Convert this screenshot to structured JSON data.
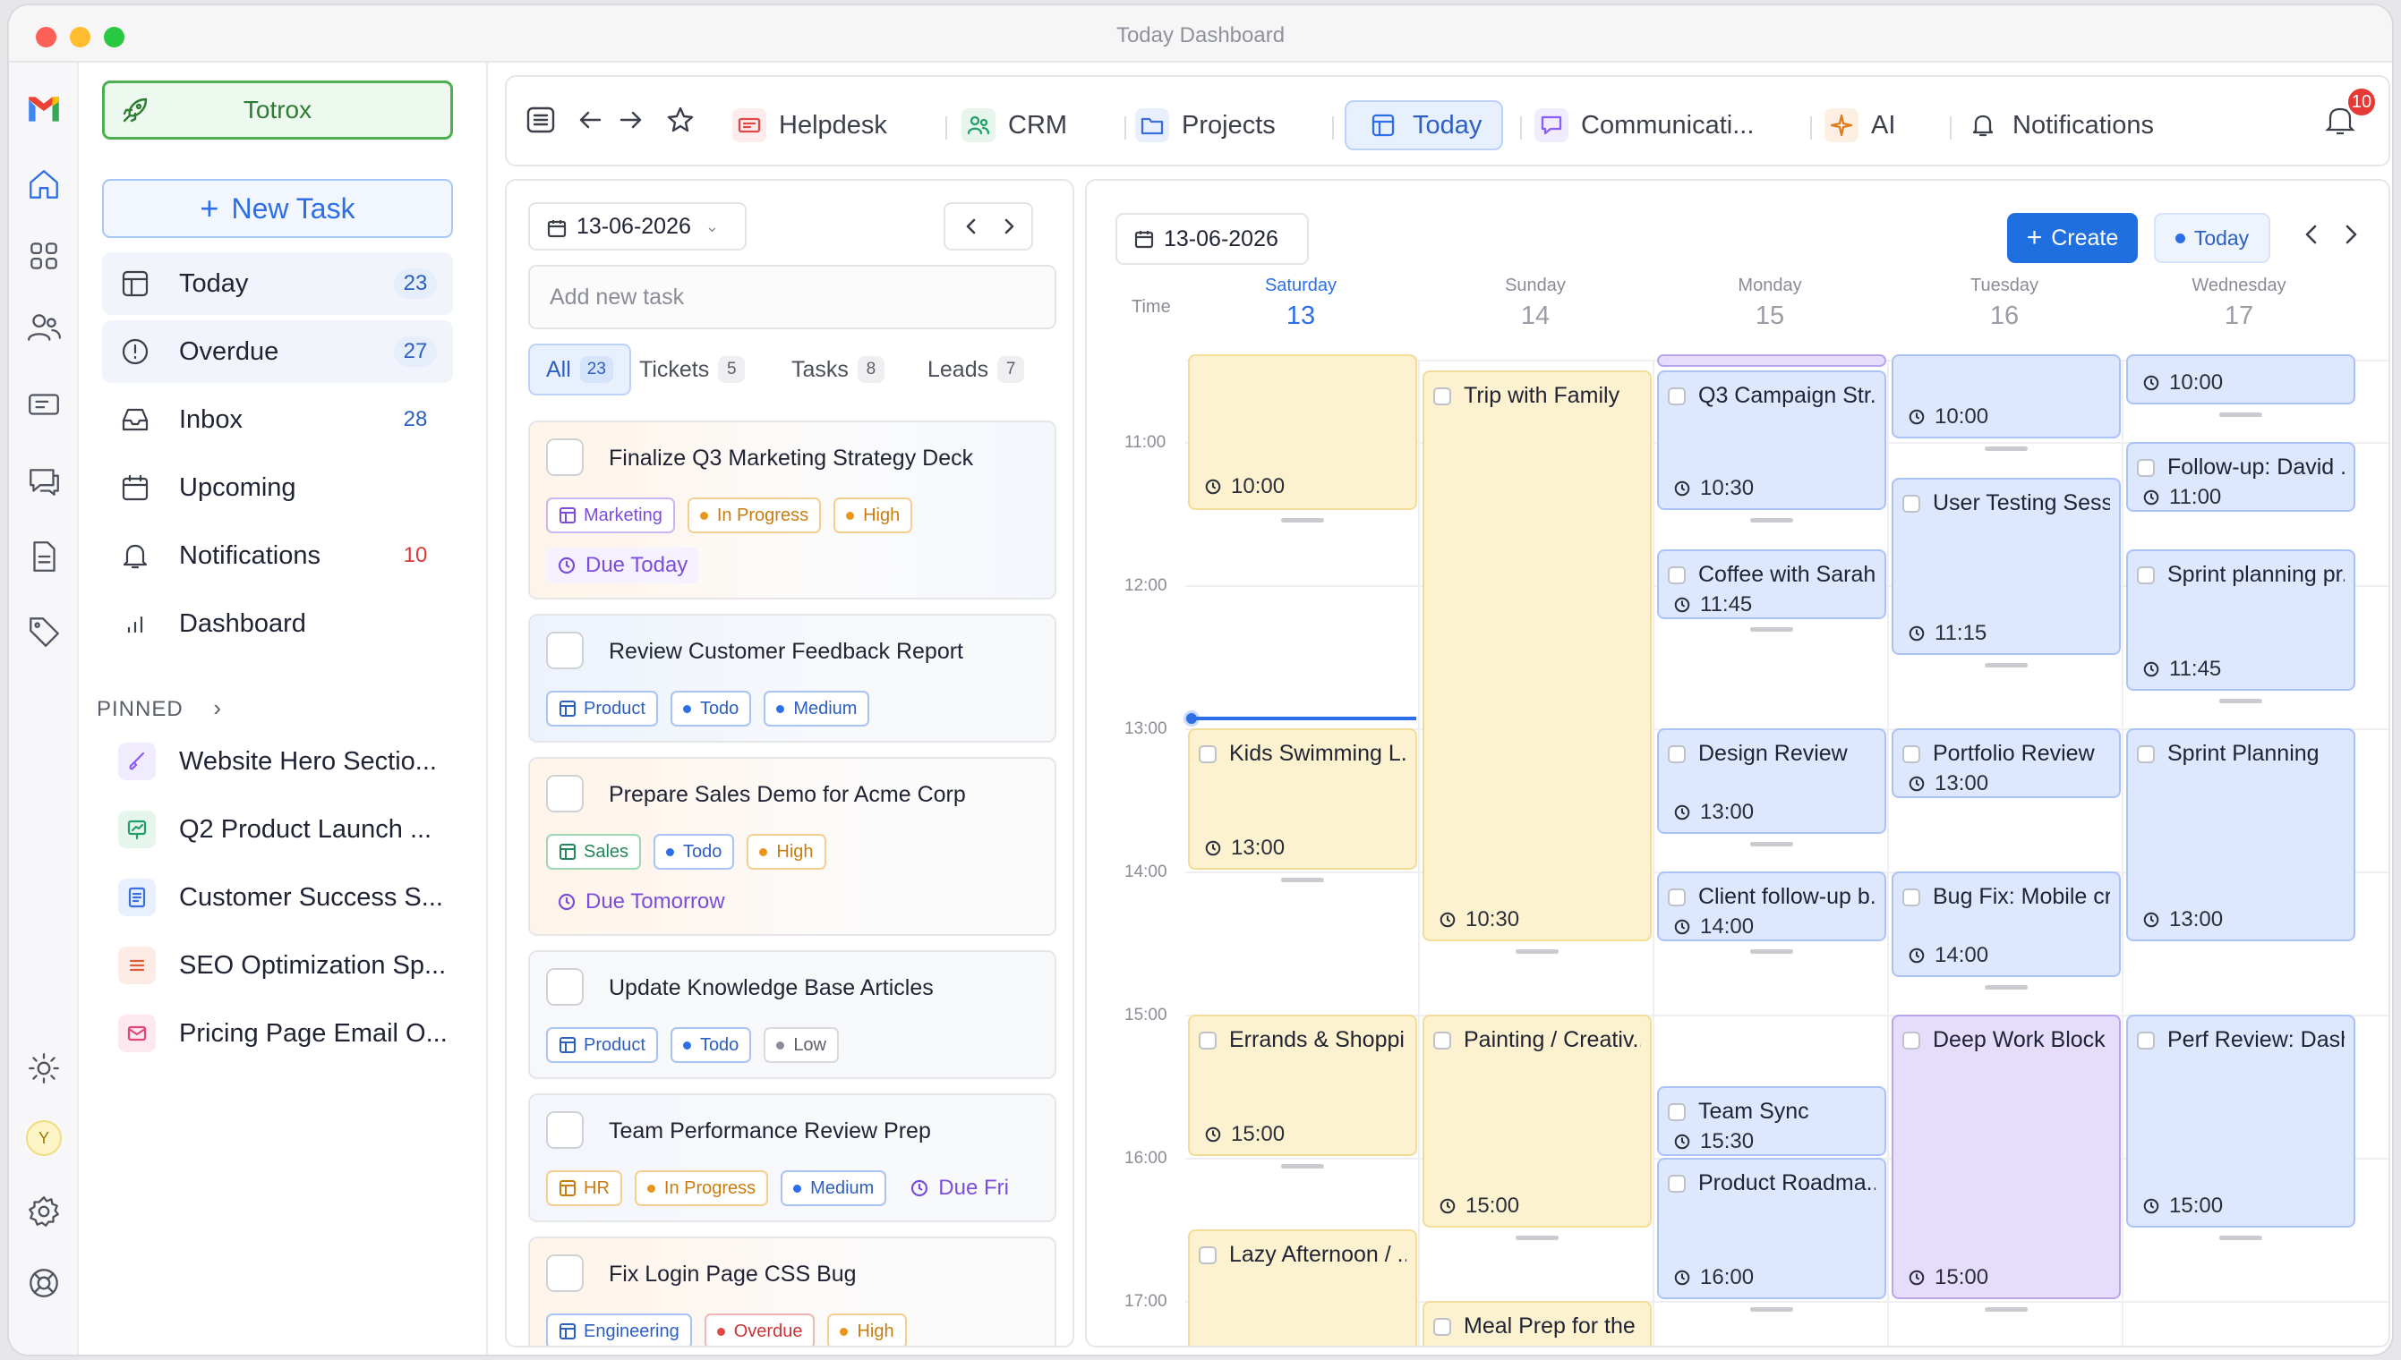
{
  "window": {
    "title": "Today Dashboard"
  },
  "sidebar": {
    "brand": "Totrox",
    "new_task": "New Task",
    "nav": [
      {
        "label": "Today",
        "count": "23"
      },
      {
        "label": "Overdue",
        "count": "27"
      },
      {
        "label": "Inbox",
        "count": "28"
      },
      {
        "label": "Upcoming",
        "count": ""
      },
      {
        "label": "Notifications",
        "count": "10"
      },
      {
        "label": "Dashboard",
        "count": ""
      }
    ],
    "pinned_label": "PINNED",
    "pinned": [
      {
        "label": "Website Hero Sectio...",
        "color": "#8b5cf6"
      },
      {
        "label": "Q2 Product Launch ...",
        "color": "#22a06b"
      },
      {
        "label": "Customer Success S...",
        "color": "#3b6fe0"
      },
      {
        "label": "SEO Optimization Sp...",
        "color": "#e05a3b"
      },
      {
        "label": "Pricing Page Email O...",
        "color": "#e0457b"
      }
    ],
    "avatar_initial": "Y"
  },
  "tabs": {
    "items": [
      {
        "label": "Helpdesk",
        "icon": "helpdesk-icon"
      },
      {
        "label": "CRM",
        "icon": "crm-icon"
      },
      {
        "label": "Projects",
        "icon": "folder-icon"
      },
      {
        "label": "Today",
        "icon": "today-icon"
      },
      {
        "label": "Communicati...",
        "icon": "chat-icon"
      },
      {
        "label": "AI",
        "icon": "sparkle-icon"
      },
      {
        "label": "Notifications",
        "icon": "bell-icon"
      }
    ],
    "bell_badge": "10"
  },
  "tasks": {
    "date": "13-06-2026",
    "add_placeholder": "Add new task",
    "filters": [
      {
        "label": "All",
        "count": "23"
      },
      {
        "label": "Tickets",
        "count": "5"
      },
      {
        "label": "Tasks",
        "count": "8"
      },
      {
        "label": "Leads",
        "count": "7"
      }
    ],
    "cards": [
      {
        "title": "Finalize Q3 Marketing Strategy Deck",
        "category": "Marketing",
        "status": "In Progress",
        "priority": "High",
        "due": "Due Today"
      },
      {
        "title": "Review Customer Feedback Report",
        "category": "Product",
        "status": "Todo",
        "priority": "Medium",
        "due": ""
      },
      {
        "title": "Prepare Sales Demo for Acme Corp",
        "category": "Sales",
        "status": "Todo",
        "priority": "High",
        "due": "Due Tomorrow"
      },
      {
        "title": "Update Knowledge Base Articles",
        "category": "Product",
        "status": "Todo",
        "priority": "Low",
        "due": ""
      },
      {
        "title": "Team Performance Review Prep",
        "category": "HR",
        "status": "In Progress",
        "priority": "Medium",
        "due": "Due Fri"
      },
      {
        "title": "Fix Login Page CSS Bug",
        "category": "Engineering",
        "status": "Overdue",
        "priority": "High",
        "due": ""
      }
    ]
  },
  "calendar": {
    "date": "13-06-2026",
    "create_label": "Create",
    "today_label": "Today",
    "time_header": "Time",
    "days": [
      {
        "name": "Saturday",
        "num": "13"
      },
      {
        "name": "Sunday",
        "num": "14"
      },
      {
        "name": "Monday",
        "num": "15"
      },
      {
        "name": "Tuesday",
        "num": "16"
      },
      {
        "name": "Wednesday",
        "num": "17"
      }
    ],
    "hours": [
      "11:00",
      "12:00",
      "13:00",
      "14:00",
      "15:00",
      "16:00",
      "17:00"
    ],
    "events": {
      "sat": [
        {
          "title": "",
          "time": "10:00"
        },
        {
          "title": "Kids Swimming L...",
          "time": "13:00"
        },
        {
          "title": "Errands & Shoppi...",
          "time": "15:00"
        },
        {
          "title": "Lazy Afternoon / ...",
          "time": ""
        }
      ],
      "sun": [
        {
          "title": "Trip with Family",
          "time": "10:30"
        },
        {
          "title": "Painting / Creativ...",
          "time": "15:00"
        },
        {
          "title": "Meal Prep for the ...",
          "time": ""
        }
      ],
      "mon": [
        {
          "title": "Q3 Campaign Str...",
          "time": "10:30"
        },
        {
          "title": "Coffee with Sarah",
          "time": "11:45"
        },
        {
          "title": "Design Review",
          "time": "13:00"
        },
        {
          "title": "Client follow-up b...",
          "time": "14:00"
        },
        {
          "title": "Team Sync",
          "time": "15:30"
        },
        {
          "title": "Product Roadma...",
          "time": "16:00"
        }
      ],
      "tue": [
        {
          "title": "",
          "time": "10:00"
        },
        {
          "title": "User Testing Sessi...",
          "time": "11:15"
        },
        {
          "title": "Portfolio Review",
          "time": "13:00"
        },
        {
          "title": "Bug Fix: Mobile cr...",
          "time": "14:00"
        },
        {
          "title": "Deep Work Block",
          "time": "15:00"
        }
      ],
      "wed": [
        {
          "title": "",
          "time": "10:00"
        },
        {
          "title": "Follow-up: David ...",
          "time": "11:00"
        },
        {
          "title": "Sprint planning pr...",
          "time": "11:45"
        },
        {
          "title": "Sprint Planning",
          "time": "13:00"
        },
        {
          "title": "Perf Review: Dash...",
          "time": "15:00"
        }
      ]
    }
  }
}
